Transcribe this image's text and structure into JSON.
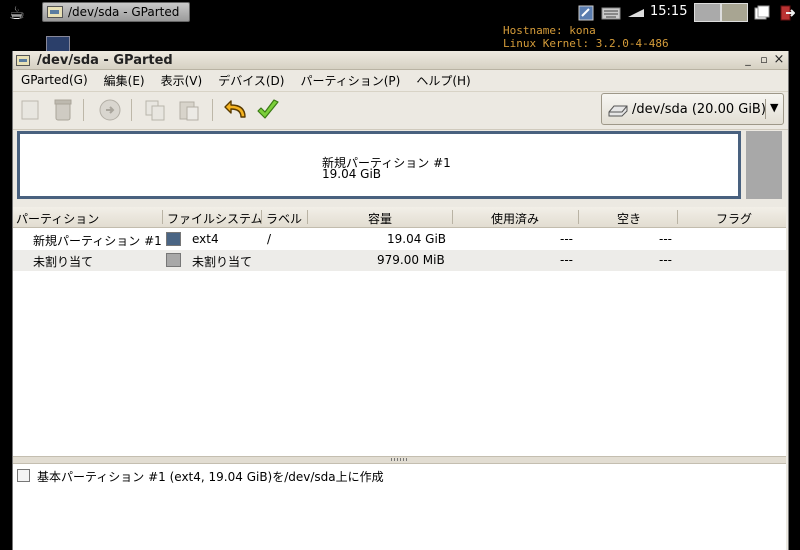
{
  "taskbar": {
    "task_title": "/dev/sda - GParted",
    "clock": "15:15"
  },
  "desktop": {
    "sysinfo": [
      "Hostname: kona",
      "Linux Kernel: 3.2.0-4-486"
    ]
  },
  "window": {
    "title": "/dev/sda - GParted",
    "minimize": "_",
    "maximize": "▫",
    "close": "×"
  },
  "menubar": [
    "GParted(G)",
    "編集(E)",
    "表示(V)",
    "デバイス(D)",
    "パーティション(P)",
    "ヘルプ(H)"
  ],
  "toolbar": {
    "icons": [
      "new-icon",
      "delete-icon",
      "resize-icon",
      "copy-icon",
      "paste-icon",
      "undo-icon",
      "apply-icon"
    ]
  },
  "device_selector": {
    "label": "/dev/sda  (20.00 GiB)"
  },
  "disk_map": {
    "partition_name": "新規パーティション #1",
    "partition_size": "19.04 GiB",
    "partition_color": "#49617f",
    "unallocated_color": "#a8a8a8"
  },
  "table": {
    "headers": [
      "パーティション",
      "ファイルシステム",
      "ラベル",
      "容量",
      "使用済み",
      "空き",
      "フラグ"
    ],
    "rows": [
      {
        "partition": "新規パーティション #1",
        "fs_color": "#4a6584",
        "filesystem": "ext4",
        "label": "/",
        "size": "19.04 GiB",
        "used": "---",
        "free": "---",
        "flags": ""
      },
      {
        "partition": "未割り当て",
        "fs_color": "#a8a8a8",
        "filesystem": "未割り当て",
        "label": "",
        "size": "979.00 MiB",
        "used": "---",
        "free": "---",
        "flags": ""
      }
    ]
  },
  "pending_operations": [
    "基本パーティション #1 (ext4, 19.04 GiB)を/dev/sda上に作成"
  ]
}
